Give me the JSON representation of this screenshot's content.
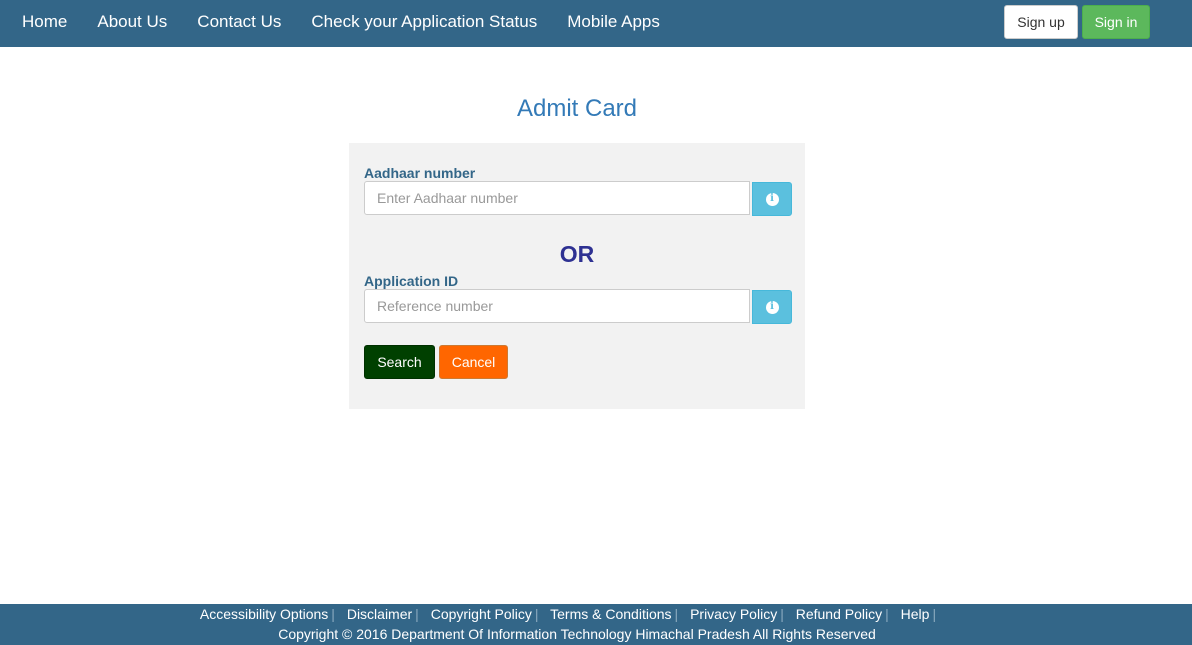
{
  "navbar": {
    "links": [
      "Home",
      "About Us",
      "Contact Us",
      "Check your Application Status",
      "Mobile Apps"
    ],
    "signup_label": "Sign up",
    "signin_label": "Sign in"
  },
  "page": {
    "title": "Admit Card"
  },
  "form": {
    "aadhaar": {
      "label": "Aadhaar number",
      "placeholder": "Enter Aadhaar number",
      "value": "",
      "info_icon": "info-circle-icon"
    },
    "or_text": "OR",
    "application": {
      "label": "Application ID",
      "placeholder": "Reference number",
      "value": "",
      "info_icon": "info-circle-icon"
    },
    "search_label": "Search",
    "cancel_label": "Cancel",
    "info_glyph": "i"
  },
  "footer": {
    "links": [
      "Accessibility Options",
      "Disclaimer",
      "Copyright Policy",
      "Terms & Conditions",
      "Privacy Policy",
      "Refund Policy",
      "Help"
    ],
    "separator": "|",
    "copyright": "Copyright © 2016 Department Of Information Technology Himachal Pradesh All Rights Reserved"
  },
  "colors": {
    "navbar": "#336688",
    "title": "#337ab7",
    "signin": "#5cb85c",
    "info": "#5bc0de",
    "or": "#2e3192",
    "search": "#004000",
    "cancel": "#ff6600"
  }
}
